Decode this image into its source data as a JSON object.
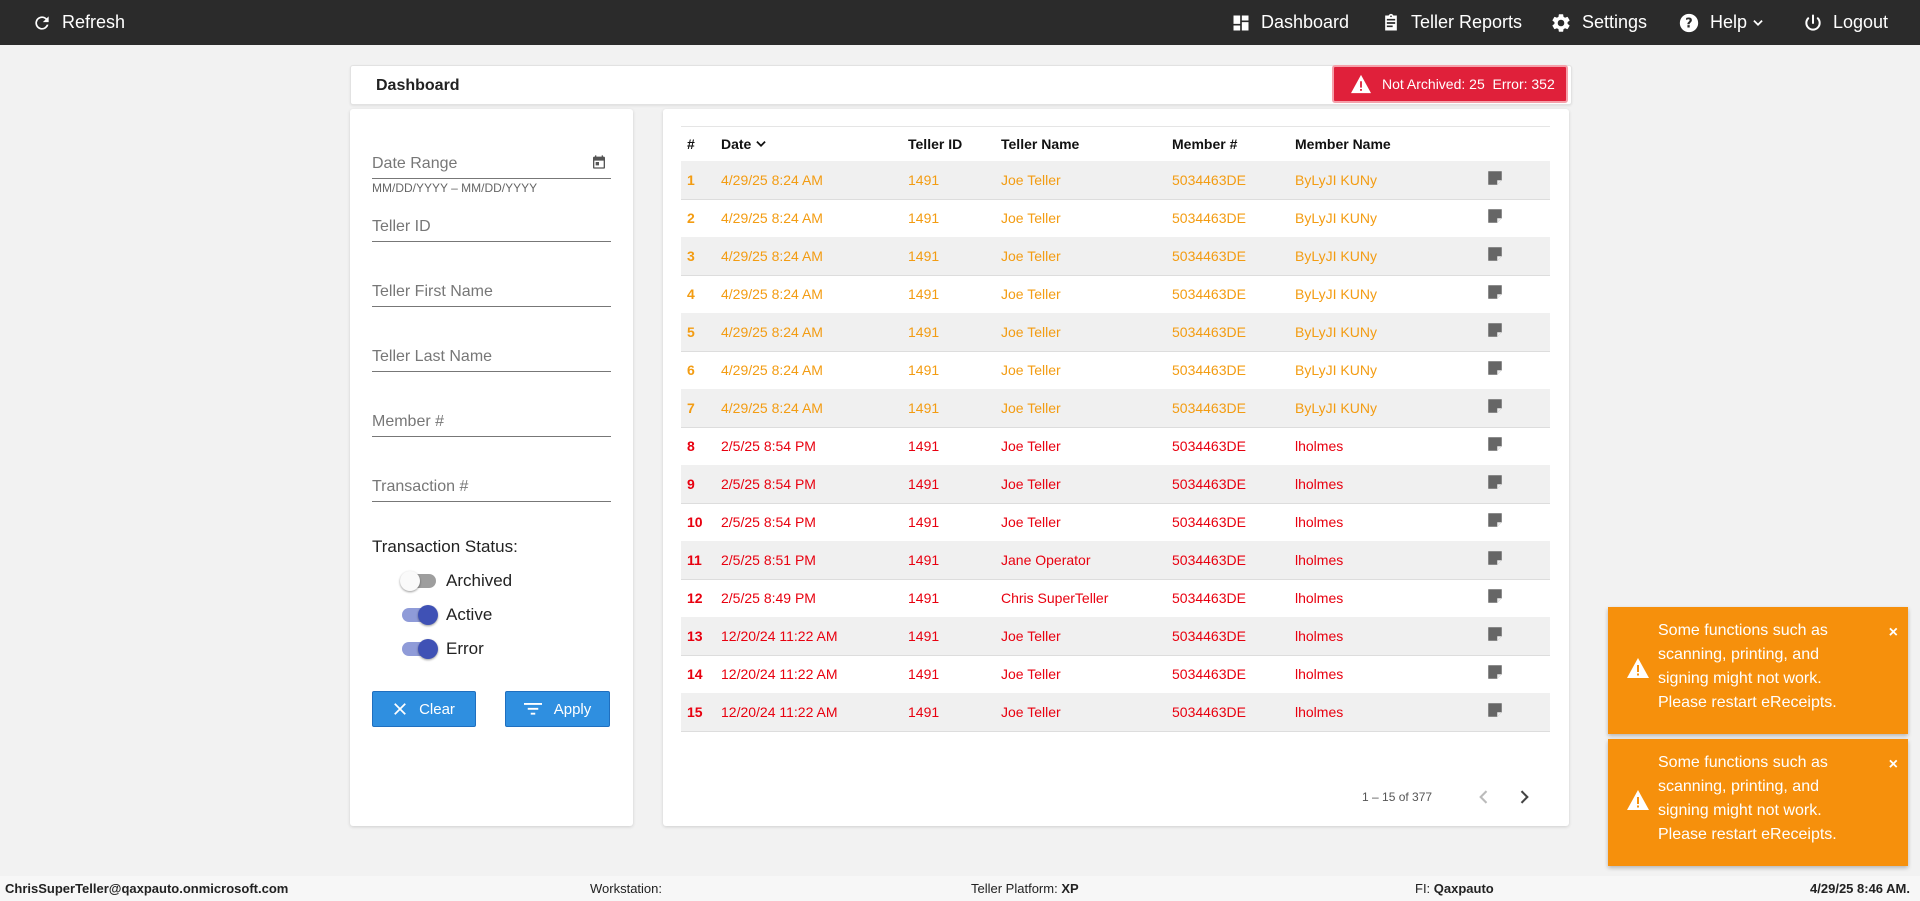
{
  "topbar": {
    "refresh_label": "Refresh",
    "nav": [
      {
        "label": "Dashboard",
        "icon": "dashboard-icon"
      },
      {
        "label": "Teller Reports",
        "icon": "clipboard-icon"
      },
      {
        "label": "Settings",
        "icon": "gear-icon"
      },
      {
        "label": "Help",
        "icon": "help-icon"
      },
      {
        "label": "Logout",
        "icon": "power-icon"
      }
    ]
  },
  "header": {
    "title": "Dashboard",
    "alert_label": "Not Archived: 25  Error: 352"
  },
  "filters": {
    "date_range": "Date Range",
    "date_hint": "MM/DD/YYYY – MM/DD/YYYY",
    "teller_id": "Teller ID",
    "teller_first_name": "Teller First Name",
    "teller_last_name": "Teller Last Name",
    "member_number": "Member #",
    "transaction_number": "Transaction #",
    "status_label": "Transaction Status:",
    "toggles": [
      {
        "label": "Archived",
        "on": false
      },
      {
        "label": "Active",
        "on": true
      },
      {
        "label": "Error",
        "on": true
      }
    ],
    "clear_label": "Clear",
    "apply_label": "Apply"
  },
  "table": {
    "columns": [
      "#",
      "Date",
      "Teller ID",
      "Teller Name",
      "Member #",
      "Member Name"
    ],
    "rows": [
      {
        "num": "1",
        "date": "4/29/25 8:24 AM",
        "teller_id": "1491",
        "teller_name": "Joe Teller",
        "member_num": "5034463DE",
        "member_name": "ByLyJI KUNy",
        "status": "warn"
      },
      {
        "num": "2",
        "date": "4/29/25 8:24 AM",
        "teller_id": "1491",
        "teller_name": "Joe Teller",
        "member_num": "5034463DE",
        "member_name": "ByLyJI KUNy",
        "status": "warn"
      },
      {
        "num": "3",
        "date": "4/29/25 8:24 AM",
        "teller_id": "1491",
        "teller_name": "Joe Teller",
        "member_num": "5034463DE",
        "member_name": "ByLyJI KUNy",
        "status": "warn"
      },
      {
        "num": "4",
        "date": "4/29/25 8:24 AM",
        "teller_id": "1491",
        "teller_name": "Joe Teller",
        "member_num": "5034463DE",
        "member_name": "ByLyJI KUNy",
        "status": "warn"
      },
      {
        "num": "5",
        "date": "4/29/25 8:24 AM",
        "teller_id": "1491",
        "teller_name": "Joe Teller",
        "member_num": "5034463DE",
        "member_name": "ByLyJI KUNy",
        "status": "warn"
      },
      {
        "num": "6",
        "date": "4/29/25 8:24 AM",
        "teller_id": "1491",
        "teller_name": "Joe Teller",
        "member_num": "5034463DE",
        "member_name": "ByLyJI KUNy",
        "status": "warn"
      },
      {
        "num": "7",
        "date": "4/29/25 8:24 AM",
        "teller_id": "1491",
        "teller_name": "Joe Teller",
        "member_num": "5034463DE",
        "member_name": "ByLyJI KUNy",
        "status": "warn"
      },
      {
        "num": "8",
        "date": "2/5/25 8:54 PM",
        "teller_id": "1491",
        "teller_name": "Joe Teller",
        "member_num": "5034463DE",
        "member_name": "lholmes",
        "status": "err"
      },
      {
        "num": "9",
        "date": "2/5/25 8:54 PM",
        "teller_id": "1491",
        "teller_name": "Joe Teller",
        "member_num": "5034463DE",
        "member_name": "lholmes",
        "status": "err"
      },
      {
        "num": "10",
        "date": "2/5/25 8:54 PM",
        "teller_id": "1491",
        "teller_name": "Joe Teller",
        "member_num": "5034463DE",
        "member_name": "lholmes",
        "status": "err"
      },
      {
        "num": "11",
        "date": "2/5/25 8:51 PM",
        "teller_id": "1491",
        "teller_name": "Jane Operator",
        "member_num": "5034463DE",
        "member_name": "lholmes",
        "status": "err"
      },
      {
        "num": "12",
        "date": "2/5/25 8:49 PM",
        "teller_id": "1491",
        "teller_name": "Chris SuperTeller",
        "member_num": "5034463DE",
        "member_name": "lholmes",
        "status": "err"
      },
      {
        "num": "13",
        "date": "12/20/24 11:22 AM",
        "teller_id": "1491",
        "teller_name": "Joe Teller",
        "member_num": "5034463DE",
        "member_name": "lholmes",
        "status": "err"
      },
      {
        "num": "14",
        "date": "12/20/24 11:22 AM",
        "teller_id": "1491",
        "teller_name": "Joe Teller",
        "member_num": "5034463DE",
        "member_name": "lholmes",
        "status": "err"
      },
      {
        "num": "15",
        "date": "12/20/24 11:22 AM",
        "teller_id": "1491",
        "teller_name": "Joe Teller",
        "member_num": "5034463DE",
        "member_name": "lholmes",
        "status": "err"
      }
    ],
    "pagination": "1 – 15 of 377"
  },
  "toasts": [
    {
      "message": "Some functions such as scanning, printing, and signing might not work. Please restart eReceipts.",
      "close": "×"
    },
    {
      "message": "Some functions such as scanning, printing, and signing might not work. Please restart eReceipts.",
      "close": "×"
    }
  ],
  "footer": {
    "user": "ChrisSuperTeller@qaxpauto.onmicrosoft.com",
    "workstation_label": "Workstation:",
    "platform_label": "Teller Platform:",
    "platform_value": "XP",
    "fi_label": "FI:",
    "fi_value": "Qaxpauto",
    "datetime": "4/29/25 8:46 AM."
  },
  "colors": {
    "topbar": "#2b2b2b",
    "alert": "#e0203a",
    "warn_row": "#f39c12",
    "error_row": "#e8000f",
    "button": "#2f8fe0",
    "toast": "#f6900c",
    "toggle_on": "#3f51b5"
  }
}
